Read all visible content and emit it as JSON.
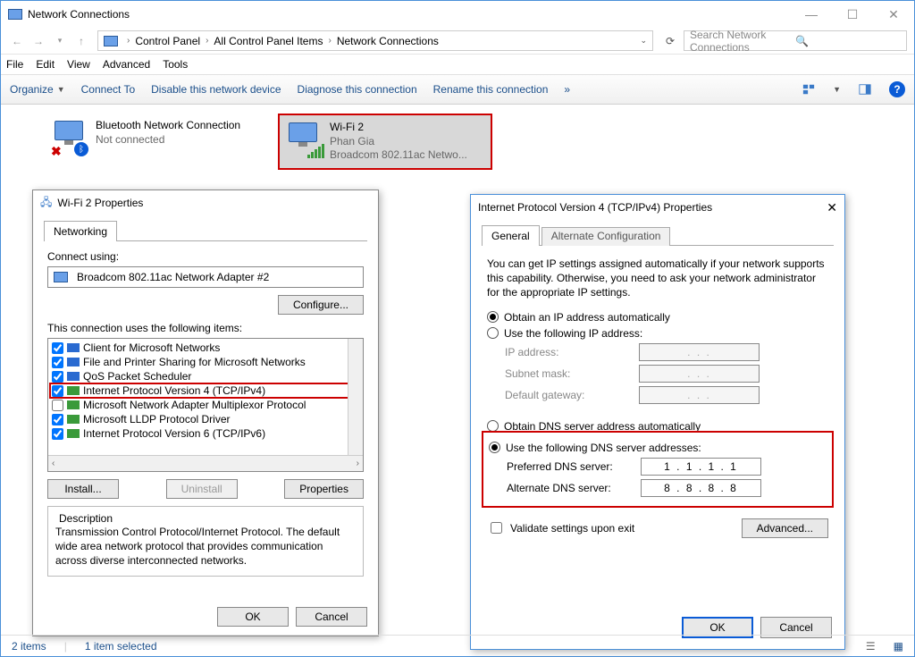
{
  "window": {
    "title": "Network Connections"
  },
  "nav": {
    "breadcrumb": [
      "Control Panel",
      "All Control Panel Items",
      "Network Connections"
    ],
    "search_placeholder": "Search Network Connections"
  },
  "menubar": [
    "File",
    "Edit",
    "View",
    "Advanced",
    "Tools"
  ],
  "toolbar": {
    "organize": "Organize",
    "connect_to": "Connect To",
    "disable": "Disable this network device",
    "diagnose": "Diagnose this connection",
    "rename": "Rename this connection",
    "more": "»"
  },
  "connections": [
    {
      "name": "Bluetooth Network Connection",
      "status": "Not connected",
      "adapter": ""
    },
    {
      "name": "Wi-Fi 2",
      "status": "Phan Gia",
      "adapter": "Broadcom 802.11ac Netwo..."
    }
  ],
  "props_dialog": {
    "title": "Wi-Fi 2 Properties",
    "tab_networking": "Networking",
    "connect_using_label": "Connect using:",
    "adapter": "Broadcom 802.11ac Network Adapter #2",
    "configure": "Configure...",
    "items_label": "This connection uses the following items:",
    "items": [
      {
        "checked": true,
        "label": "Client for Microsoft Networks",
        "icon": "net"
      },
      {
        "checked": true,
        "label": "File and Printer Sharing for Microsoft Networks",
        "icon": "net"
      },
      {
        "checked": true,
        "label": "QoS Packet Scheduler",
        "icon": "net"
      },
      {
        "checked": true,
        "label": "Internet Protocol Version 4 (TCP/IPv4)",
        "icon": "proto",
        "hl": true
      },
      {
        "checked": false,
        "label": "Microsoft Network Adapter Multiplexor Protocol",
        "icon": "proto"
      },
      {
        "checked": true,
        "label": "Microsoft LLDP Protocol Driver",
        "icon": "proto"
      },
      {
        "checked": true,
        "label": "Internet Protocol Version 6 (TCP/IPv6)",
        "icon": "proto"
      }
    ],
    "install": "Install...",
    "uninstall": "Uninstall",
    "properties": "Properties",
    "desc_title": "Description",
    "desc_text": "Transmission Control Protocol/Internet Protocol. The default wide area network protocol that provides communication across diverse interconnected networks.",
    "ok": "OK",
    "cancel": "Cancel"
  },
  "ipv4_dialog": {
    "title": "Internet Protocol Version 4 (TCP/IPv4) Properties",
    "tab_general": "General",
    "tab_alt": "Alternate Configuration",
    "intro": "You can get IP settings assigned automatically if your network supports this capability. Otherwise, you need to ask your network administrator for the appropriate IP settings.",
    "ip_auto": "Obtain an IP address automatically",
    "ip_manual": "Use the following IP address:",
    "ip_address": "IP address:",
    "subnet": "Subnet mask:",
    "gateway": "Default gateway:",
    "dns_auto": "Obtain DNS server address automatically",
    "dns_manual": "Use the following DNS server addresses:",
    "dns_pref_label": "Preferred DNS server:",
    "dns_alt_label": "Alternate DNS server:",
    "dns_pref": "1 . 1 . 1 . 1",
    "dns_alt": "8 . 8 . 8 . 8",
    "validate": "Validate settings upon exit",
    "advanced": "Advanced...",
    "ok": "OK",
    "cancel": "Cancel",
    "ip_dots": ".       .       ."
  },
  "statusbar": {
    "items": "2 items",
    "selected": "1 item selected"
  }
}
